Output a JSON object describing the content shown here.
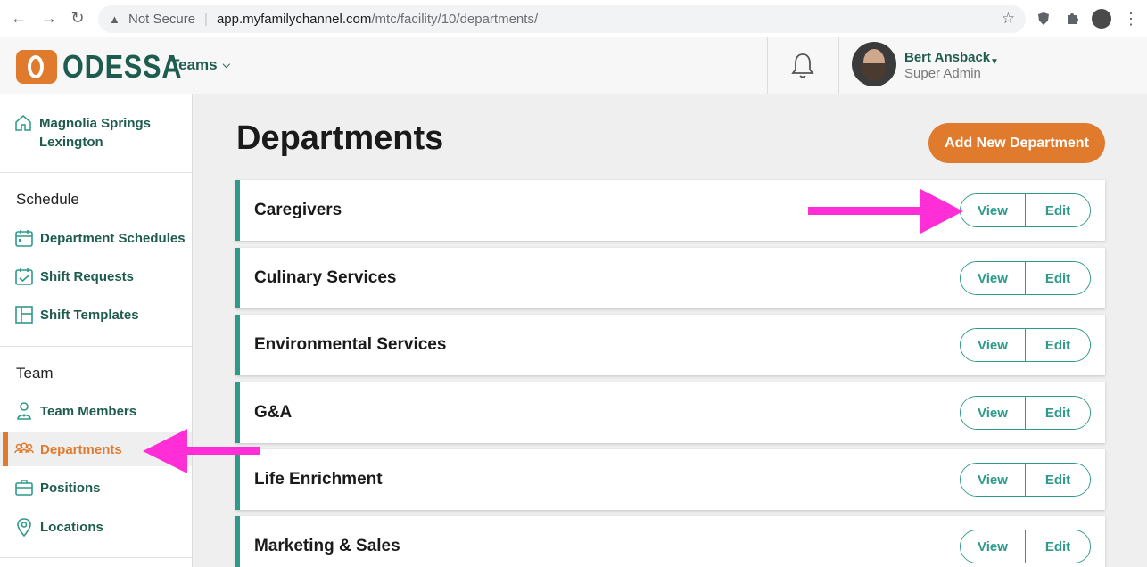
{
  "browser": {
    "not_secure": "Not Secure",
    "url_host": "app.myfamilychannel.com",
    "url_path": "/mtc/facility/10/departments/"
  },
  "header": {
    "logo_text": "ODESSA",
    "teams_menu": "Teams",
    "user_name": "Bert Ansback",
    "user_role": "Super Admin"
  },
  "sidebar": {
    "facility_name": "Magnolia Springs Lexington",
    "schedule_title": "Schedule",
    "schedule_items": [
      {
        "label": "Department Schedules",
        "icon": "calendar-icon"
      },
      {
        "label": "Shift Requests",
        "icon": "calendar-check-icon"
      },
      {
        "label": "Shift Templates",
        "icon": "layout-icon"
      }
    ],
    "team_title": "Team",
    "team_items": [
      {
        "label": "Team Members",
        "icon": "person-icon"
      },
      {
        "label": "Departments",
        "icon": "people-group-icon",
        "active": true
      },
      {
        "label": "Positions",
        "icon": "briefcase-icon"
      },
      {
        "label": "Locations",
        "icon": "map-pin-icon"
      }
    ]
  },
  "main": {
    "title": "Departments",
    "add_button": "Add New Department",
    "view_label": "View",
    "edit_label": "Edit",
    "departments": [
      "Caregivers",
      "Culinary Services",
      "Environmental Services",
      "G&A",
      "Life Enrichment",
      "Marketing & Sales"
    ]
  },
  "colors": {
    "brand_orange": "#e07b2e",
    "brand_green": "#1e5c4f",
    "accent_teal": "#2e9a8a",
    "annotation_magenta": "#ff2ed6"
  }
}
